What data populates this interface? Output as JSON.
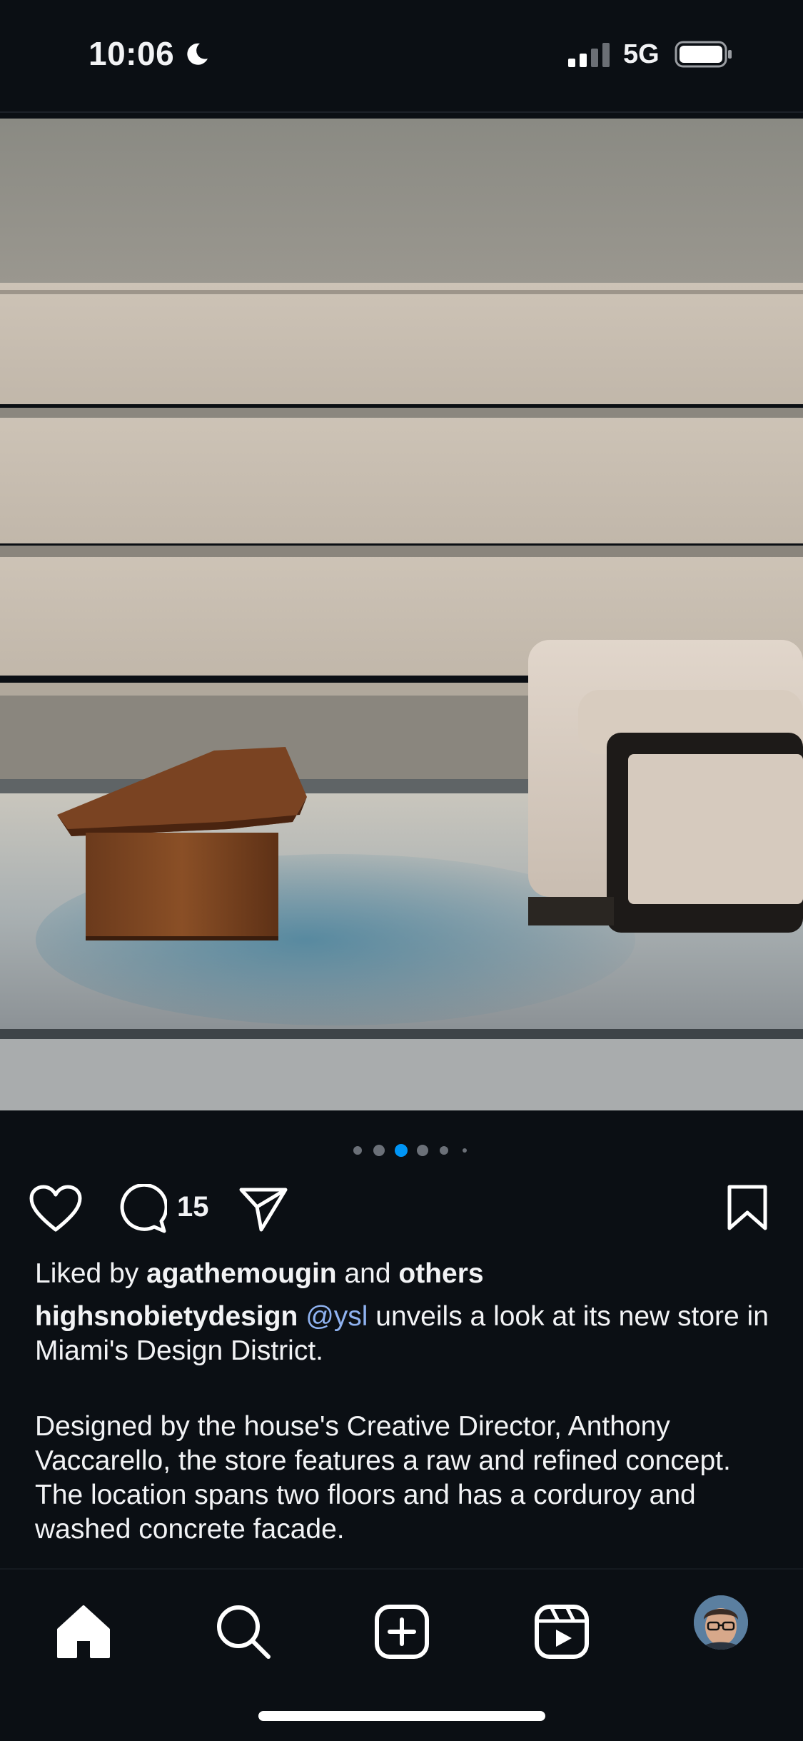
{
  "status_bar": {
    "time": "10:06",
    "network": "5G",
    "moon_icon": "moon-icon",
    "signal_icon": "cellular-signal-icon",
    "battery_icon": "battery-icon"
  },
  "post": {
    "image_alt": "interior with wood bench and sofa on rug",
    "carousel": {
      "count": 6,
      "active_index": 2
    },
    "actions": {
      "comment_count": "15"
    },
    "liked_prefix": "Liked by ",
    "liked_user": "agathemougin",
    "liked_and": " and ",
    "liked_others": "others",
    "author": "highsnobietydesign",
    "mention": "@ysl",
    "caption_rest": " unveils a look at its new store in Miami's Design District.",
    "caption_paragraph_2": "Designed by the house's Creative Director, Anthony Vaccarello, the store features a raw and refined concept. The location spans two floors and has a corduroy and washed concrete facade."
  },
  "bottom_nav": {
    "items": [
      "home-icon",
      "search-icon",
      "create-icon",
      "reels-icon",
      "profile-avatar"
    ]
  },
  "colors": {
    "background": "#0b0f14",
    "accent": "#0095f6",
    "mention": "#8fb2f0"
  }
}
